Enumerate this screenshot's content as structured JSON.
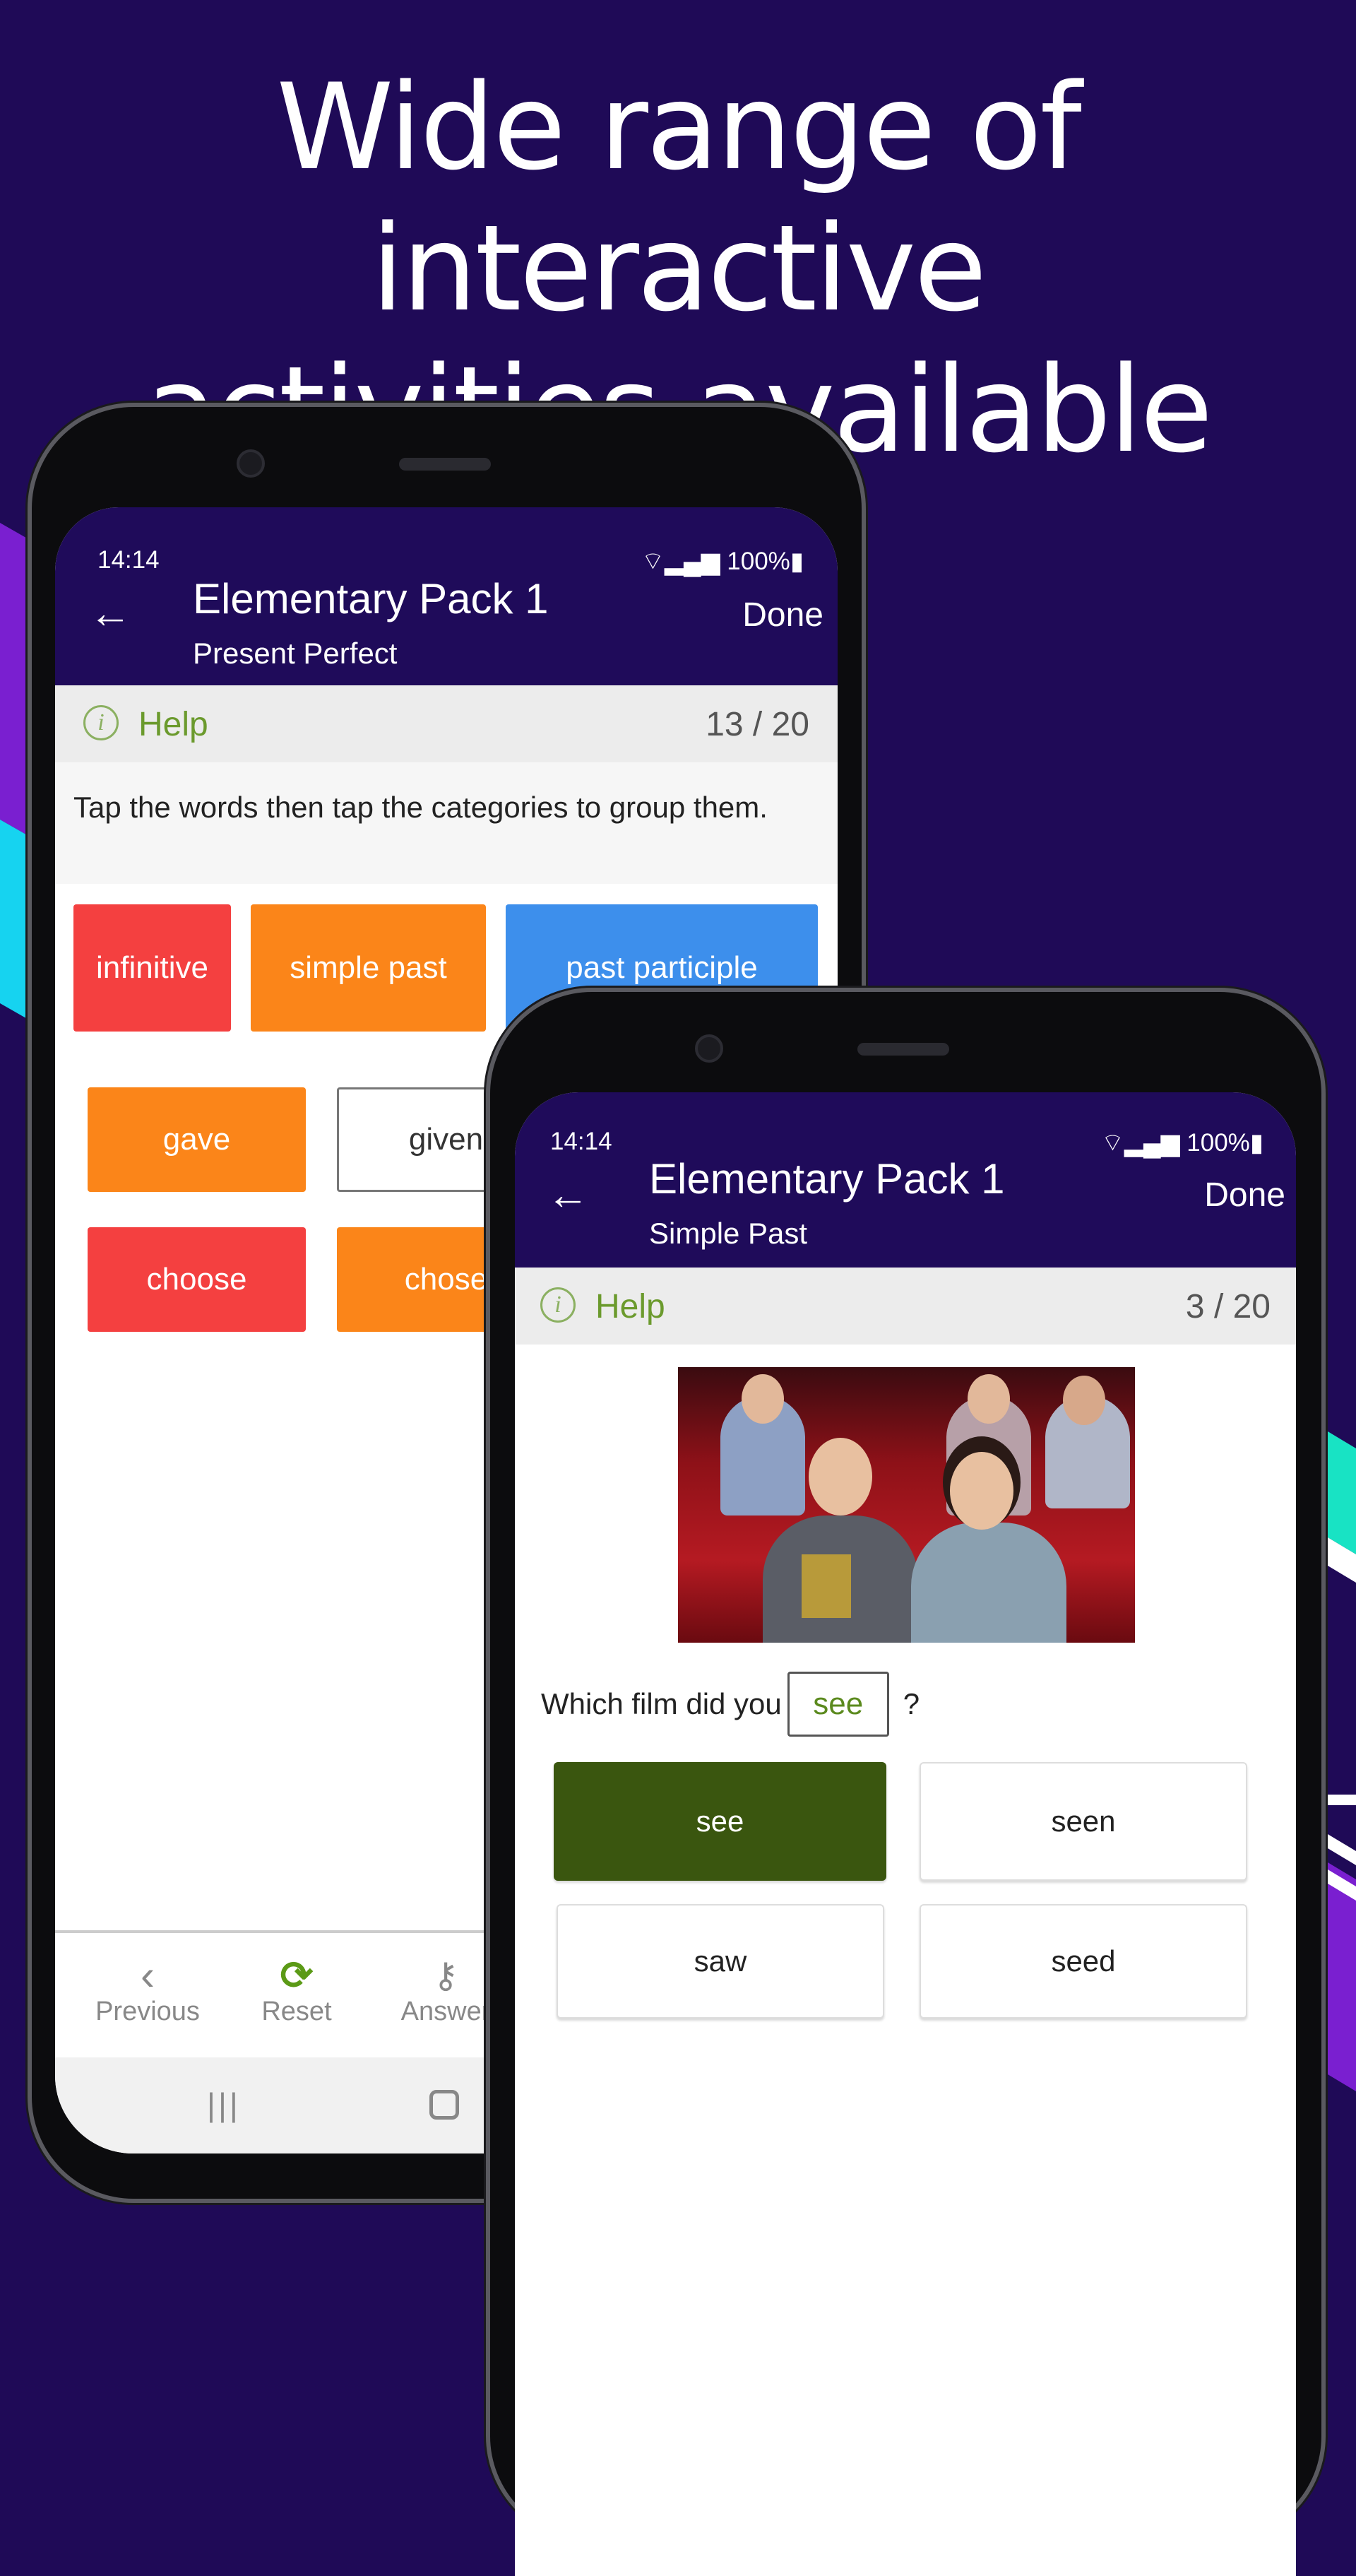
{
  "headline": {
    "line1": "Wide range of interactive",
    "line2": "activities available"
  },
  "colors": {
    "background": "#1f0a57",
    "appbar": "#1f0b5a",
    "help_green": "#6b9a2d",
    "red": "#f44040",
    "orange": "#fb8519",
    "blue": "#3d8fec",
    "selected_green": "#3a560f"
  },
  "phone1": {
    "status": {
      "time": "14:14",
      "icons": "wifi-icon signal-icon battery-icon",
      "battery": "100%"
    },
    "appbar": {
      "back_icon": "arrow-left-icon",
      "title": "Elementary Pack 1",
      "subtitle": "Present Perfect",
      "done": "Done"
    },
    "helpbar": {
      "icon": "info-icon",
      "help": "Help",
      "count": "13 / 20"
    },
    "instruction": "Tap the words then tap the categories to group them.",
    "categories": [
      {
        "label": "infinitive"
      },
      {
        "label": "simple past"
      },
      {
        "label": "past participle"
      }
    ],
    "words": [
      {
        "label": "gave"
      },
      {
        "label": "given"
      },
      {
        "label": "choose"
      },
      {
        "label": "chose"
      }
    ],
    "bottom_nav": [
      {
        "label": "Previous",
        "icon": "chevron-left-icon"
      },
      {
        "label": "Reset",
        "icon": "reset-icon"
      },
      {
        "label": "Answer",
        "icon": "key-icon"
      }
    ],
    "system_nav": [
      "recents-icon",
      "home-icon"
    ]
  },
  "phone2": {
    "status": {
      "time": "14:14",
      "battery": "100%"
    },
    "appbar": {
      "title": "Elementary Pack 1",
      "subtitle": "Simple Past",
      "done": "Done"
    },
    "helpbar": {
      "help": "Help",
      "count": "3 / 20"
    },
    "image": "cinema-audience-photo",
    "question": {
      "before": "Which film did you",
      "blank": "see",
      "after": "?"
    },
    "answers": [
      {
        "label": "see",
        "selected": true
      },
      {
        "label": "seen"
      },
      {
        "label": "saw"
      },
      {
        "label": "seed"
      }
    ]
  }
}
